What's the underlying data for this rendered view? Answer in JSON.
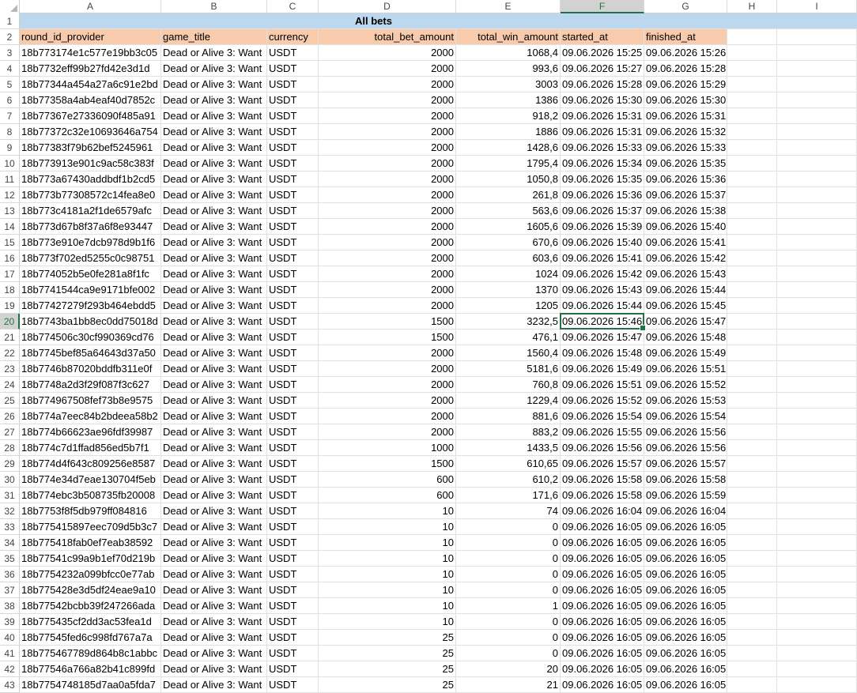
{
  "columns": [
    "A",
    "B",
    "C",
    "D",
    "E",
    "F",
    "G",
    "H",
    "I"
  ],
  "active_column": "F",
  "active_row": 20,
  "title": "All bets",
  "headers": [
    "round_id_provider",
    "game_title",
    "currency",
    "total_bet_amount",
    "total_win_amount",
    "started_at",
    "finished_at"
  ],
  "rows": [
    {
      "n": 3,
      "id": "18b773174e1c577e19bb3c05",
      "game": "Dead or Alive 3: Want",
      "cur": "USDT",
      "bet": "2000",
      "win": "1068,4",
      "start": "09.06.2026 15:25",
      "end": "09.06.2026 15:26"
    },
    {
      "n": 4,
      "id": "18b7732eff99b27fd42e3d1d",
      "game": "Dead or Alive 3: Want",
      "cur": "USDT",
      "bet": "2000",
      "win": "993,6",
      "start": "09.06.2026 15:27",
      "end": "09.06.2026 15:28"
    },
    {
      "n": 5,
      "id": "18b77344a454a27a6c91e2bd",
      "game": "Dead or Alive 3: Want",
      "cur": "USDT",
      "bet": "2000",
      "win": "3003",
      "start": "09.06.2026 15:28",
      "end": "09.06.2026 15:29"
    },
    {
      "n": 6,
      "id": "18b77358a4ab4eaf40d7852c",
      "game": "Dead or Alive 3: Want",
      "cur": "USDT",
      "bet": "2000",
      "win": "1386",
      "start": "09.06.2026 15:30",
      "end": "09.06.2026 15:30"
    },
    {
      "n": 7,
      "id": "18b77367e27336090f485a91",
      "game": "Dead or Alive 3: Want",
      "cur": "USDT",
      "bet": "2000",
      "win": "918,2",
      "start": "09.06.2026 15:31",
      "end": "09.06.2026 15:31"
    },
    {
      "n": 8,
      "id": "18b77372c32e10693646a754",
      "game": "Dead or Alive 3: Want",
      "cur": "USDT",
      "bet": "2000",
      "win": "1886",
      "start": "09.06.2026 15:31",
      "end": "09.06.2026 15:32"
    },
    {
      "n": 9,
      "id": "18b77383f79b62bef5245961",
      "game": "Dead or Alive 3: Want",
      "cur": "USDT",
      "bet": "2000",
      "win": "1428,6",
      "start": "09.06.2026 15:33",
      "end": "09.06.2026 15:33"
    },
    {
      "n": 10,
      "id": "18b773913e901c9ac58c383f",
      "game": "Dead or Alive 3: Want",
      "cur": "USDT",
      "bet": "2000",
      "win": "1795,4",
      "start": "09.06.2026 15:34",
      "end": "09.06.2026 15:35"
    },
    {
      "n": 11,
      "id": "18b773a67430addbdf1b2cd5",
      "game": "Dead or Alive 3: Want",
      "cur": "USDT",
      "bet": "2000",
      "win": "1050,8",
      "start": "09.06.2026 15:35",
      "end": "09.06.2026 15:36"
    },
    {
      "n": 12,
      "id": "18b773b77308572c14fea8e0",
      "game": "Dead or Alive 3: Want",
      "cur": "USDT",
      "bet": "2000",
      "win": "261,8",
      "start": "09.06.2026 15:36",
      "end": "09.06.2026 15:37"
    },
    {
      "n": 13,
      "id": "18b773c4181a2f1de6579afc",
      "game": "Dead or Alive 3: Want",
      "cur": "USDT",
      "bet": "2000",
      "win": "563,6",
      "start": "09.06.2026 15:37",
      "end": "09.06.2026 15:38"
    },
    {
      "n": 14,
      "id": "18b773d67b8f37a6f8e93447",
      "game": "Dead or Alive 3: Want",
      "cur": "USDT",
      "bet": "2000",
      "win": "1605,6",
      "start": "09.06.2026 15:39",
      "end": "09.06.2026 15:40"
    },
    {
      "n": 15,
      "id": "18b773e910e7dcb978d9b1f6",
      "game": "Dead or Alive 3: Want",
      "cur": "USDT",
      "bet": "2000",
      "win": "670,6",
      "start": "09.06.2026 15:40",
      "end": "09.06.2026 15:41"
    },
    {
      "n": 16,
      "id": "18b773f702ed5255c0c98751",
      "game": "Dead or Alive 3: Want",
      "cur": "USDT",
      "bet": "2000",
      "win": "603,6",
      "start": "09.06.2026 15:41",
      "end": "09.06.2026 15:42"
    },
    {
      "n": 17,
      "id": "18b774052b5e0fe281a8f1fc",
      "game": "Dead or Alive 3: Want",
      "cur": "USDT",
      "bet": "2000",
      "win": "1024",
      "start": "09.06.2026 15:42",
      "end": "09.06.2026 15:43"
    },
    {
      "n": 18,
      "id": "18b7741544ca9e9171bfe002",
      "game": "Dead or Alive 3: Want",
      "cur": "USDT",
      "bet": "2000",
      "win": "1370",
      "start": "09.06.2026 15:43",
      "end": "09.06.2026 15:44"
    },
    {
      "n": 19,
      "id": "18b77427279f293b464ebdd5",
      "game": "Dead or Alive 3: Want",
      "cur": "USDT",
      "bet": "2000",
      "win": "1205",
      "start": "09.06.2026 15:44",
      "end": "09.06.2026 15:45"
    },
    {
      "n": 20,
      "id": "18b7743ba1bb8ec0dd75018d",
      "game": "Dead or Alive 3: Want",
      "cur": "USDT",
      "bet": "1500",
      "win": "3232,5",
      "start": "09.06.2026 15:46",
      "end": "09.06.2026 15:47"
    },
    {
      "n": 21,
      "id": "18b774506c30cf990369cd76",
      "game": "Dead or Alive 3: Want",
      "cur": "USDT",
      "bet": "1500",
      "win": "476,1",
      "start": "09.06.2026 15:47",
      "end": "09.06.2026 15:48"
    },
    {
      "n": 22,
      "id": "18b7745bef85a64643d37a50",
      "game": "Dead or Alive 3: Want",
      "cur": "USDT",
      "bet": "2000",
      "win": "1560,4",
      "start": "09.06.2026 15:48",
      "end": "09.06.2026 15:49"
    },
    {
      "n": 23,
      "id": "18b7746b87020bddfb311e0f",
      "game": "Dead or Alive 3: Want",
      "cur": "USDT",
      "bet": "2000",
      "win": "5181,6",
      "start": "09.06.2026 15:49",
      "end": "09.06.2026 15:51"
    },
    {
      "n": 24,
      "id": "18b7748a2d3f29f087f3c627",
      "game": "Dead or Alive 3: Want",
      "cur": "USDT",
      "bet": "2000",
      "win": "760,8",
      "start": "09.06.2026 15:51",
      "end": "09.06.2026 15:52"
    },
    {
      "n": 25,
      "id": "18b774967508fef73b8e9575",
      "game": "Dead or Alive 3: Want",
      "cur": "USDT",
      "bet": "2000",
      "win": "1229,4",
      "start": "09.06.2026 15:52",
      "end": "09.06.2026 15:53"
    },
    {
      "n": 26,
      "id": "18b774a7eec84b2bdeea58b2",
      "game": "Dead or Alive 3: Want",
      "cur": "USDT",
      "bet": "2000",
      "win": "881,6",
      "start": "09.06.2026 15:54",
      "end": "09.06.2026 15:54"
    },
    {
      "n": 27,
      "id": "18b774b66623ae96fdf39987",
      "game": "Dead or Alive 3: Want",
      "cur": "USDT",
      "bet": "2000",
      "win": "883,2",
      "start": "09.06.2026 15:55",
      "end": "09.06.2026 15:56"
    },
    {
      "n": 28,
      "id": "18b774c7d1ffad856ed5b7f1",
      "game": "Dead or Alive 3: Want",
      "cur": "USDT",
      "bet": "1000",
      "win": "1433,5",
      "start": "09.06.2026 15:56",
      "end": "09.06.2026 15:56"
    },
    {
      "n": 29,
      "id": "18b774d4f643c809256e8587",
      "game": "Dead or Alive 3: Want",
      "cur": "USDT",
      "bet": "1500",
      "win": "610,65",
      "start": "09.06.2026 15:57",
      "end": "09.06.2026 15:57"
    },
    {
      "n": 30,
      "id": "18b774e34d7eae130704f5eb",
      "game": "Dead or Alive 3: Want",
      "cur": "USDT",
      "bet": "600",
      "win": "610,2",
      "start": "09.06.2026 15:58",
      "end": "09.06.2026 15:58"
    },
    {
      "n": 31,
      "id": "18b774ebc3b508735fb20008",
      "game": "Dead or Alive 3: Want",
      "cur": "USDT",
      "bet": "600",
      "win": "171,6",
      "start": "09.06.2026 15:58",
      "end": "09.06.2026 15:59"
    },
    {
      "n": 32,
      "id": "18b7753f8f5db979ff084816",
      "game": "Dead or Alive 3: Want",
      "cur": "USDT",
      "bet": "10",
      "win": "74",
      "start": "09.06.2026 16:04",
      "end": "09.06.2026 16:04"
    },
    {
      "n": 33,
      "id": "18b775415897eec709d5b3c7",
      "game": "Dead or Alive 3: Want",
      "cur": "USDT",
      "bet": "10",
      "win": "0",
      "start": "09.06.2026 16:05",
      "end": "09.06.2026 16:05"
    },
    {
      "n": 34,
      "id": "18b775418fab0ef7eab38592",
      "game": "Dead or Alive 3: Want",
      "cur": "USDT",
      "bet": "10",
      "win": "0",
      "start": "09.06.2026 16:05",
      "end": "09.06.2026 16:05"
    },
    {
      "n": 35,
      "id": "18b77541c99a9b1ef70d219b",
      "game": "Dead or Alive 3: Want",
      "cur": "USDT",
      "bet": "10",
      "win": "0",
      "start": "09.06.2026 16:05",
      "end": "09.06.2026 16:05"
    },
    {
      "n": 36,
      "id": "18b7754232a099bfcc0e77ab",
      "game": "Dead or Alive 3: Want",
      "cur": "USDT",
      "bet": "10",
      "win": "0",
      "start": "09.06.2026 16:05",
      "end": "09.06.2026 16:05"
    },
    {
      "n": 37,
      "id": "18b775428e3d5df24eae9a10",
      "game": "Dead or Alive 3: Want",
      "cur": "USDT",
      "bet": "10",
      "win": "0",
      "start": "09.06.2026 16:05",
      "end": "09.06.2026 16:05"
    },
    {
      "n": 38,
      "id": "18b77542bcbb39f247266ada",
      "game": "Dead or Alive 3: Want",
      "cur": "USDT",
      "bet": "10",
      "win": "1",
      "start": "09.06.2026 16:05",
      "end": "09.06.2026 16:05"
    },
    {
      "n": 39,
      "id": "18b775435cf2dd3ac53fea1d",
      "game": "Dead or Alive 3: Want",
      "cur": "USDT",
      "bet": "10",
      "win": "0",
      "start": "09.06.2026 16:05",
      "end": "09.06.2026 16:05"
    },
    {
      "n": 40,
      "id": "18b77545fed6c998fd767a7a",
      "game": "Dead or Alive 3: Want",
      "cur": "USDT",
      "bet": "25",
      "win": "0",
      "start": "09.06.2026 16:05",
      "end": "09.06.2026 16:05"
    },
    {
      "n": 41,
      "id": "18b775467789d864b8c1abbc",
      "game": "Dead or Alive 3: Want",
      "cur": "USDT",
      "bet": "25",
      "win": "0",
      "start": "09.06.2026 16:05",
      "end": "09.06.2026 16:05"
    },
    {
      "n": 42,
      "id": "18b77546a766a82b41c899fd",
      "game": "Dead or Alive 3: Want",
      "cur": "USDT",
      "bet": "25",
      "win": "20",
      "start": "09.06.2026 16:05",
      "end": "09.06.2026 16:05"
    },
    {
      "n": 43,
      "id": "18b7754748185d7aa0a5fda7",
      "game": "Dead or Alive 3: Want",
      "cur": "USDT",
      "bet": "25",
      "win": "21",
      "start": "09.06.2026 16:05",
      "end": "09.06.2026 16:05"
    }
  ]
}
